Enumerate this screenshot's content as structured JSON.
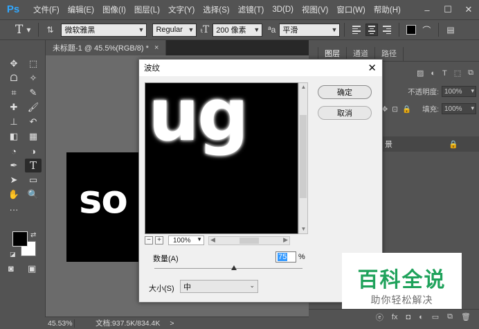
{
  "app": {
    "logo": "Ps",
    "menu": [
      "文件(F)",
      "编辑(E)",
      "图像(I)",
      "图层(L)",
      "文字(Y)",
      "选择(S)",
      "滤镜(T)",
      "3D(D)",
      "视图(V)",
      "窗口(W)",
      "帮助(H)"
    ],
    "window_controls": [
      "–",
      "☐",
      "✕"
    ]
  },
  "options_bar": {
    "tool_icon": "T",
    "font_family": "微软雅黑",
    "font_style": "Regular",
    "font_size": "200 像素",
    "aa_icon": "ªa",
    "anti_alias": "平滑",
    "text_color": "#000000"
  },
  "document": {
    "tab_title": "未标题-1 @ 45.5%(RGB/8) *",
    "tab_close": "×",
    "canvas_text": "so"
  },
  "status": {
    "zoom": "45.53%",
    "doc_info": "文档:937.5K/834.4K",
    "arrow": ">"
  },
  "panels": {
    "tabs": [
      "图层",
      "通道",
      "路径"
    ],
    "opacity_label": "不透明度:",
    "opacity_value": "100%",
    "fill_label": "填充:",
    "fill_value": "100%",
    "layer_name": "景",
    "bottom_icons": [
      "ⓔ",
      "fx",
      "◘",
      "◐",
      "▭",
      "⧉",
      "🗑"
    ]
  },
  "dialog": {
    "title": "波纹",
    "close": "✕",
    "preview_text": "ug",
    "ok_label": "确定",
    "cancel_label": "取消",
    "zoom_minus": "−",
    "zoom_plus": "+",
    "zoom_value": "100%",
    "amount_label": "数量(A)",
    "amount_value": "75",
    "amount_unit": "%",
    "amount_range": [
      -999,
      999
    ],
    "size_label": "大小(S)",
    "size_value": "中"
  },
  "watermark": {
    "title": "百科全说",
    "subtitle": "助你轻松解决"
  },
  "colors": {
    "foreground": "#000000",
    "background": "#ffffff",
    "watermark_green": "#1fa25b"
  }
}
